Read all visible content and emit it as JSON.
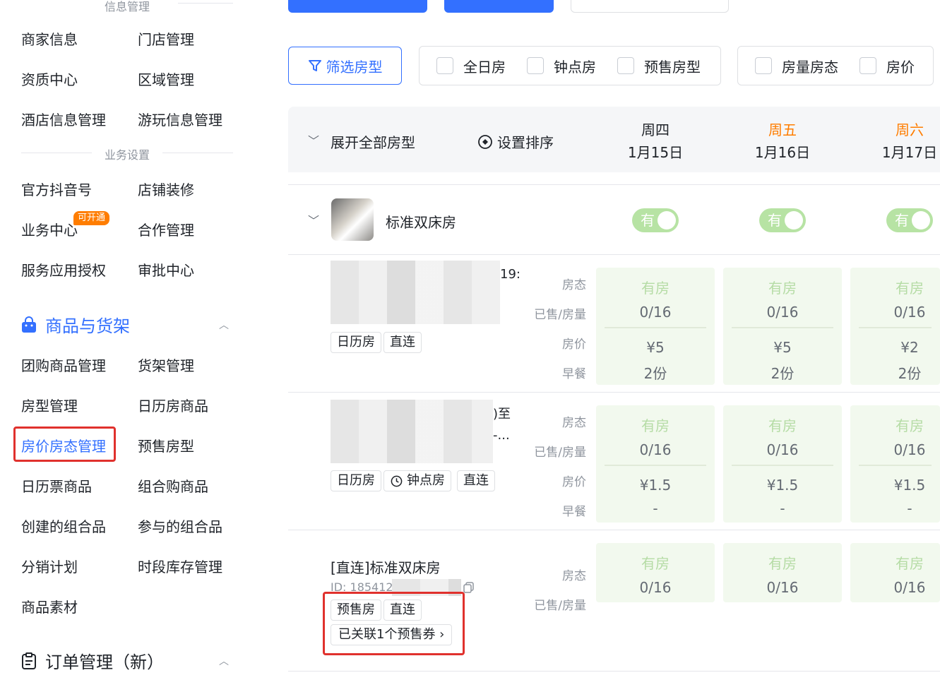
{
  "sidebar": {
    "divider_info": "信息管理",
    "divider_business": "业务设置",
    "info_items": [
      "商家信息",
      "门店管理",
      "资质中心",
      "区域管理",
      "酒店信息管理",
      "游玩信息管理"
    ],
    "business_items": [
      "官方抖音号",
      "店铺装修",
      "业务中心",
      "合作管理",
      "服务应用授权",
      "审批中心"
    ],
    "business_badge": "可开通",
    "goods_section": "商品与货架",
    "goods_items": [
      "团购商品管理",
      "货架管理",
      "房型管理",
      "日历房商品",
      "房价房态管理",
      "预售房型",
      "日历票商品",
      "组合购商品",
      "创建的组合品",
      "参与的组合品",
      "分销计划",
      "时段库存管理",
      "商品素材"
    ],
    "order_section": "订单管理（新）"
  },
  "toolbar": {
    "filter_room": "筛选房型",
    "room_types": [
      "全日房",
      "钟点房",
      "预售房型"
    ],
    "display_opts": [
      "房量房态",
      "房价"
    ]
  },
  "table": {
    "expand_all": "展开全部房型",
    "set_sort": "设置排序",
    "days": [
      {
        "weekday": "周四",
        "date": "1月15日"
      },
      {
        "weekday": "周五",
        "date": "1月16日"
      },
      {
        "weekday": "周六",
        "date": "1月17日"
      }
    ],
    "room_name": "标准双床房",
    "toggle_label": "有",
    "labels": {
      "status": "房态",
      "sold": "已售/房量",
      "price": "房价",
      "breakfast": "早餐"
    },
    "rows": [
      {
        "title_tail": "19:",
        "tags": [
          "日历房",
          "直连"
        ],
        "cells": [
          {
            "status": "有房",
            "sold": "0/16",
            "price": "¥5",
            "breakfast": "2份"
          },
          {
            "status": "有房",
            "sold": "0/16",
            "price": "¥5",
            "breakfast": "2份"
          },
          {
            "status": "有房",
            "sold": "0/16",
            "price": "¥2",
            "breakfast": "2份"
          }
        ]
      },
      {
        "title_tail": ")至",
        "title_tail2": "-...",
        "tags": [
          "日历房",
          "钟点房",
          "直连"
        ],
        "cells": [
          {
            "status": "有房",
            "sold": "0/16",
            "price": "¥1.5",
            "breakfast": "-"
          },
          {
            "status": "有房",
            "sold": "0/16",
            "price": "¥1.5",
            "breakfast": "-"
          },
          {
            "status": "有房",
            "sold": "0/16",
            "price": "¥1.5",
            "breakfast": "-"
          }
        ]
      },
      {
        "title": "[直连]标准双床房",
        "id_text": "ID: 185412",
        "tags": [
          "预售房",
          "直连"
        ],
        "linked": "已关联1个预售券 ›",
        "cells": [
          {
            "status": "有房",
            "sold": "0/16"
          },
          {
            "status": "有房",
            "sold": "0/16"
          },
          {
            "status": "有房",
            "sold": "0/16"
          }
        ]
      }
    ]
  },
  "colors": {
    "accent": "#3370ff",
    "weekend": "#ff7d00",
    "highlight": "#e0312d",
    "available": "#b5dca5"
  }
}
